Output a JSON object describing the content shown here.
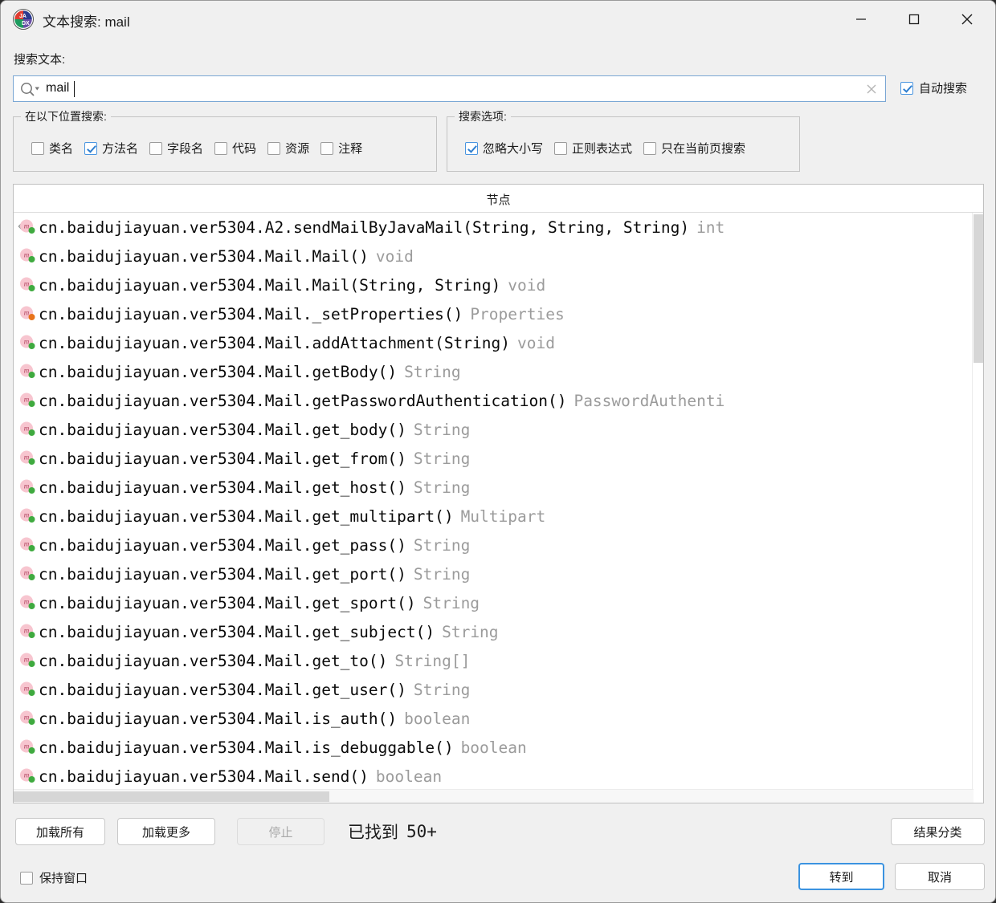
{
  "window": {
    "title": "文本搜索: mail",
    "app_icon": "jadx-logo-icon",
    "minimize_label": "最小化",
    "maximize_label": "最大化",
    "close_label": "关闭"
  },
  "search": {
    "label": "搜索文本:",
    "value": "mail",
    "placeholder": "",
    "magnifier_icon": "search-icon",
    "clear_icon": "clear-icon",
    "auto_search": {
      "label": "自动搜索",
      "checked": true
    }
  },
  "where_group": {
    "title": "在以下位置搜索:",
    "items": [
      {
        "label": "类名",
        "checked": false
      },
      {
        "label": "方法名",
        "checked": true
      },
      {
        "label": "字段名",
        "checked": false
      },
      {
        "label": "代码",
        "checked": false
      },
      {
        "label": "资源",
        "checked": false
      },
      {
        "label": "注释",
        "checked": false
      }
    ]
  },
  "options_group": {
    "title": "搜索选项:",
    "items": [
      {
        "label": "忽略大小写",
        "checked": true
      },
      {
        "label": "正则表达式",
        "checked": false
      },
      {
        "label": "只在当前页搜索",
        "checked": false
      }
    ]
  },
  "results": {
    "column_header": "节点",
    "rows": [
      {
        "icon": "method-public-override-icon",
        "text": "cn.baidujiayuan.ver5304.A2.sendMailByJavaMail(String, String, String)",
        "type": "int",
        "visibility": "public",
        "overridden": true
      },
      {
        "icon": "method-public-icon",
        "text": "cn.baidujiayuan.ver5304.Mail.Mail()",
        "type": "void",
        "visibility": "public",
        "overridden": false
      },
      {
        "icon": "method-public-icon",
        "text": "cn.baidujiayuan.ver5304.Mail.Mail(String, String)",
        "type": "void",
        "visibility": "public",
        "overridden": false
      },
      {
        "icon": "method-private-icon",
        "text": "cn.baidujiayuan.ver5304.Mail._setProperties()",
        "type": "Properties",
        "visibility": "private",
        "overridden": false
      },
      {
        "icon": "method-public-icon",
        "text": "cn.baidujiayuan.ver5304.Mail.addAttachment(String)",
        "type": "void",
        "visibility": "public",
        "overridden": false
      },
      {
        "icon": "method-public-icon",
        "text": "cn.baidujiayuan.ver5304.Mail.getBody()",
        "type": "String",
        "visibility": "public",
        "overridden": false
      },
      {
        "icon": "method-public-icon",
        "text": "cn.baidujiayuan.ver5304.Mail.getPasswordAuthentication()",
        "type": "PasswordAuthenti",
        "visibility": "public",
        "overridden": false
      },
      {
        "icon": "method-public-icon",
        "text": "cn.baidujiayuan.ver5304.Mail.get_body()",
        "type": "String",
        "visibility": "public",
        "overridden": false
      },
      {
        "icon": "method-public-icon",
        "text": "cn.baidujiayuan.ver5304.Mail.get_from()",
        "type": "String",
        "visibility": "public",
        "overridden": false
      },
      {
        "icon": "method-public-icon",
        "text": "cn.baidujiayuan.ver5304.Mail.get_host()",
        "type": "String",
        "visibility": "public",
        "overridden": false
      },
      {
        "icon": "method-public-icon",
        "text": "cn.baidujiayuan.ver5304.Mail.get_multipart()",
        "type": "Multipart",
        "visibility": "public",
        "overridden": false
      },
      {
        "icon": "method-public-icon",
        "text": "cn.baidujiayuan.ver5304.Mail.get_pass()",
        "type": "String",
        "visibility": "public",
        "overridden": false
      },
      {
        "icon": "method-public-icon",
        "text": "cn.baidujiayuan.ver5304.Mail.get_port()",
        "type": "String",
        "visibility": "public",
        "overridden": false
      },
      {
        "icon": "method-public-icon",
        "text": "cn.baidujiayuan.ver5304.Mail.get_sport()",
        "type": "String",
        "visibility": "public",
        "overridden": false
      },
      {
        "icon": "method-public-icon",
        "text": "cn.baidujiayuan.ver5304.Mail.get_subject()",
        "type": "String",
        "visibility": "public",
        "overridden": false
      },
      {
        "icon": "method-public-icon",
        "text": "cn.baidujiayuan.ver5304.Mail.get_to()",
        "type": "String[]",
        "visibility": "public",
        "overridden": false
      },
      {
        "icon": "method-public-icon",
        "text": "cn.baidujiayuan.ver5304.Mail.get_user()",
        "type": "String",
        "visibility": "public",
        "overridden": false
      },
      {
        "icon": "method-public-icon",
        "text": "cn.baidujiayuan.ver5304.Mail.is_auth()",
        "type": "boolean",
        "visibility": "public",
        "overridden": false
      },
      {
        "icon": "method-public-icon",
        "text": "cn.baidujiayuan.ver5304.Mail.is_debuggable()",
        "type": "boolean",
        "visibility": "public",
        "overridden": false
      },
      {
        "icon": "method-public-icon",
        "text": "cn.baidujiayuan.ver5304.Mail.send()",
        "type": "boolean",
        "visibility": "public",
        "overridden": false
      }
    ]
  },
  "footer": {
    "load_all": "加载所有",
    "load_more": "加载更多",
    "stop": "停止",
    "stop_disabled": true,
    "found_label": "已找到",
    "found_count": "50+",
    "group_results": "结果分类",
    "keep_window": {
      "label": "保持窗口",
      "checked": false
    },
    "goto": "转到",
    "cancel": "取消"
  },
  "colors": {
    "accent": "#3b93e0",
    "method_icon_bg": "#f7c5cf",
    "public_dot": "#3faa3f",
    "private_dot": "#e8731a",
    "type_text": "#9b9b9b",
    "window_bg": "#f0f0f0"
  }
}
